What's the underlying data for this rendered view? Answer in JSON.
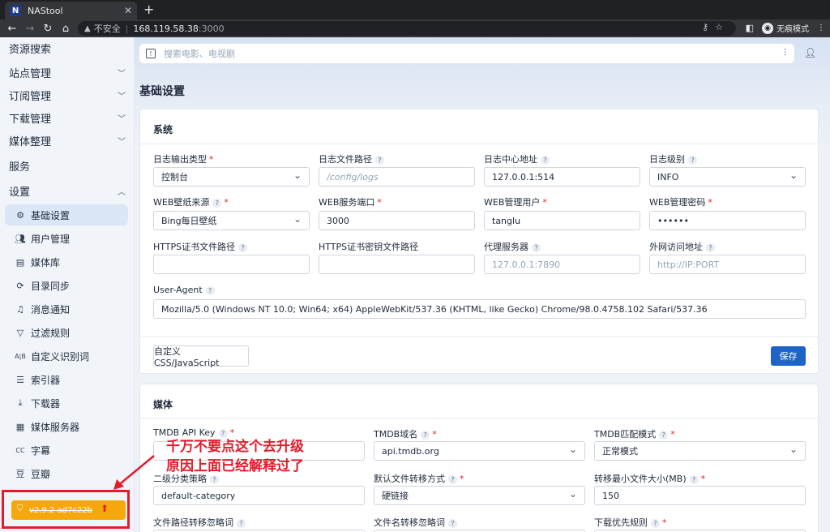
{
  "browser": {
    "tab_title": "NAStool",
    "tab_favicon": "N",
    "insecure_label": "不安全",
    "url_host": "168.119.58.38",
    "url_port": ":3000",
    "incognito_label": "无痕模式"
  },
  "sidebar": {
    "items": [
      {
        "label": "资源搜索"
      },
      {
        "label": "站点管理"
      },
      {
        "label": "订阅管理"
      },
      {
        "label": "下载管理"
      },
      {
        "label": "媒体整理"
      },
      {
        "label": "服务"
      },
      {
        "label": "设置"
      }
    ],
    "sub_items": [
      {
        "label": "基础设置",
        "icon": "gear-icon"
      },
      {
        "label": "用户管理",
        "icon": "users-icon"
      },
      {
        "label": "媒体库",
        "icon": "library-icon"
      },
      {
        "label": "目录同步",
        "icon": "sync-icon"
      },
      {
        "label": "消息通知",
        "icon": "bell-icon"
      },
      {
        "label": "过滤规则",
        "icon": "filter-icon"
      },
      {
        "label": "自定义识别词",
        "icon": "ab-icon"
      },
      {
        "label": "索引器",
        "icon": "indexer-icon"
      },
      {
        "label": "下载器",
        "icon": "download-icon"
      },
      {
        "label": "媒体服务器",
        "icon": "server-icon"
      },
      {
        "label": "字幕",
        "icon": "subtitle-icon"
      },
      {
        "label": "豆瓣",
        "icon": "douban-icon"
      }
    ],
    "version": "v2.9.2 ad7c22b"
  },
  "header": {
    "search_placeholder": "搜索电影、电视剧"
  },
  "page_title": "基础设置",
  "system": {
    "title": "系统",
    "fields": [
      {
        "label": "日志输出类型",
        "value": "控制台"
      },
      {
        "label": "日志文件路径",
        "placeholder": "/config/logs"
      },
      {
        "label": "日志中心地址",
        "value": "127.0.0.1:514"
      },
      {
        "label": "日志级别",
        "value": "INFO"
      },
      {
        "label": "WEB壁纸来源",
        "value": "Bing每日壁纸"
      },
      {
        "label": "WEB服务端口",
        "value": "3000"
      },
      {
        "label": "WEB管理用户",
        "value": "tanglu"
      },
      {
        "label": "WEB管理密码",
        "value": "••••••"
      },
      {
        "label": "HTTPS证书文件路径",
        "value": ""
      },
      {
        "label": "HTTPS证书密钥文件路径",
        "value": ""
      },
      {
        "label": "代理服务器",
        "placeholder": "127.0.0.1:7890"
      },
      {
        "label": "外网访问地址",
        "placeholder": "http://IP:PORT"
      },
      {
        "label": "User-Agent",
        "value": "Mozilla/5.0 (Windows NT 10.0; Win64; x64) AppleWebKit/537.36 (KHTML, like Gecko) Chrome/98.0.4758.102 Safari/537.36"
      }
    ],
    "custom_css_button": "自定义 CSS/JavaScript",
    "save_button": "保存"
  },
  "media": {
    "title": "媒体",
    "fields": [
      {
        "label": "TMDB API Key",
        "value": ""
      },
      {
        "label": "TMDB域名",
        "value": "api.tmdb.org"
      },
      {
        "label": "TMDB匹配模式",
        "value": "正常模式"
      },
      {
        "label": "二级分类策略",
        "value": "default-category"
      },
      {
        "label": "默认文件转移方式",
        "value": "硬链接"
      },
      {
        "label": "转移最小文件大小(MB)",
        "value": "150"
      },
      {
        "label": "文件路径转移忽略词",
        "value": ""
      },
      {
        "label": "文件名转移忽略词",
        "value": ""
      },
      {
        "label": "下载优先规则",
        "value": ""
      }
    ]
  },
  "annotation": {
    "line1": "千万不要点这个去升级",
    "line2": "原因上面已经解释过了"
  },
  "colors": {
    "accent": "#1d64c6",
    "version_button": "#f5a80d",
    "annotation_red": "#e11d2b"
  }
}
